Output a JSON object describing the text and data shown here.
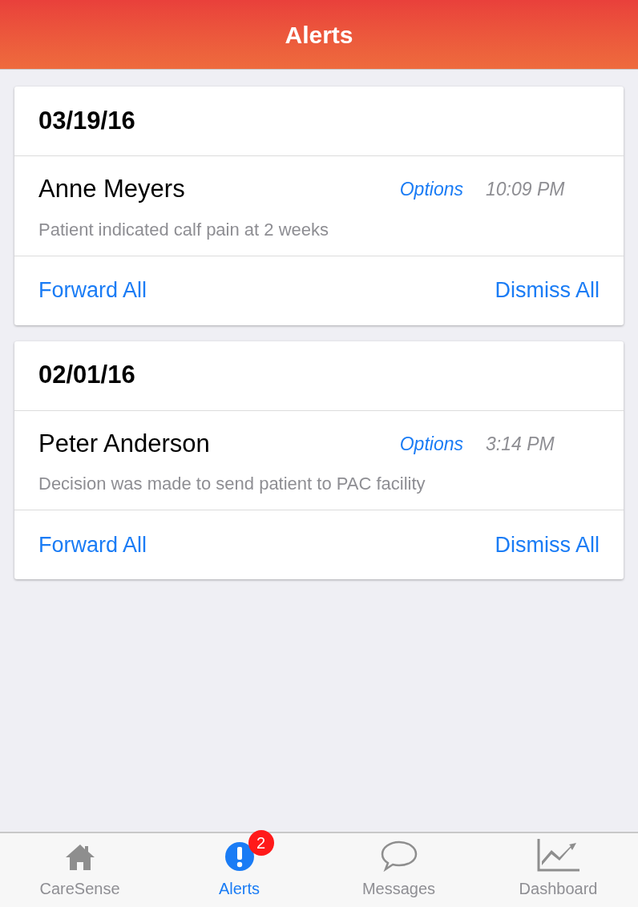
{
  "header": {
    "title": "Alerts"
  },
  "groups": [
    {
      "date": "03/19/16",
      "alerts": [
        {
          "name": "Anne Meyers",
          "options": "Options",
          "time": "10:09 PM",
          "message": "Patient indicated calf pain at 2 weeks"
        }
      ],
      "actions": [
        "Forward All",
        "Dismiss All"
      ]
    },
    {
      "date": "02/01/16",
      "alerts": [
        {
          "name": "Peter Anderson",
          "options": "Options",
          "time": "3:14 PM",
          "message": "Decision was made to send patient to PAC facility"
        }
      ],
      "actions": [
        "Forward All",
        "Dismiss All"
      ]
    }
  ],
  "tab_bar": [
    {
      "kind": "home",
      "label": "CareSense",
      "selected": false
    },
    {
      "kind": "alert",
      "label": "Alerts",
      "selected": true,
      "badge": "2"
    },
    {
      "kind": "chat",
      "label": "Messages",
      "selected": false
    },
    {
      "kind": "chart",
      "label": "Dashboard",
      "selected": false
    }
  ]
}
